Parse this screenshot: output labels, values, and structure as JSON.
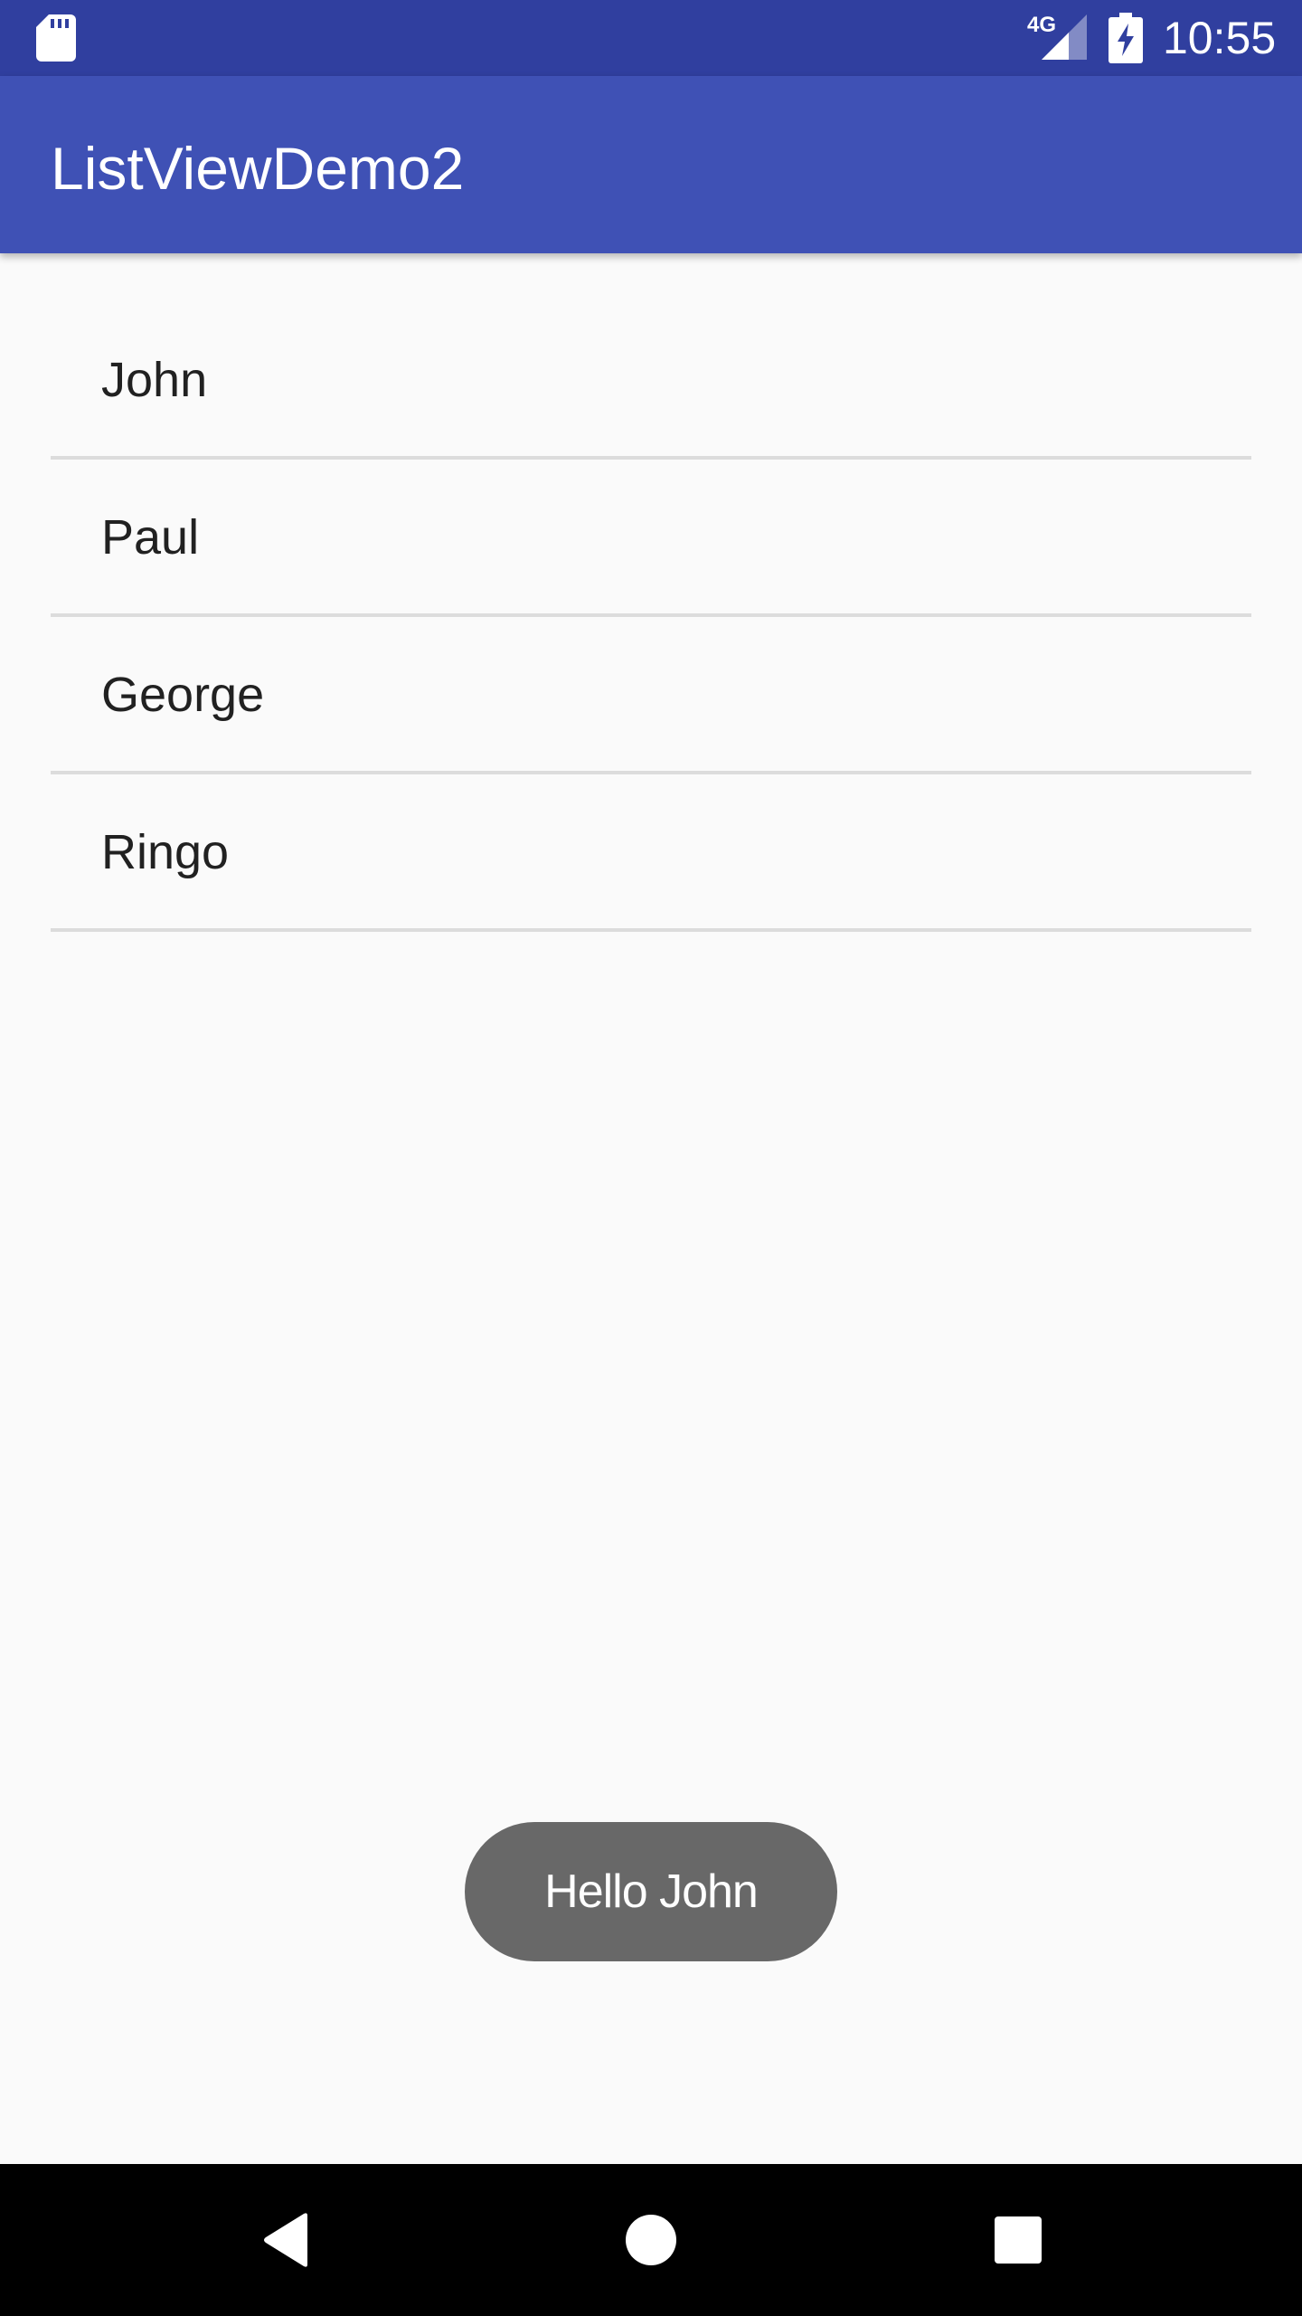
{
  "status_bar": {
    "network": "4G",
    "time": "10:55",
    "icons": [
      "sd-card-icon",
      "signal-icon",
      "battery-charging-icon"
    ]
  },
  "app_bar": {
    "title": "ListViewDemo2"
  },
  "list": {
    "items": [
      {
        "label": "John"
      },
      {
        "label": "Paul"
      },
      {
        "label": "George"
      },
      {
        "label": "Ringo"
      }
    ]
  },
  "toast": {
    "message": "Hello John"
  },
  "nav_bar": {
    "icons": [
      "back-icon",
      "home-icon",
      "recents-icon"
    ]
  },
  "colors": {
    "status_bar": "#303f9f",
    "app_bar": "#3f51b5",
    "background": "#fafafa",
    "divider": "#dcdcdc",
    "toast": "#686868",
    "nav_bar": "#000000"
  }
}
